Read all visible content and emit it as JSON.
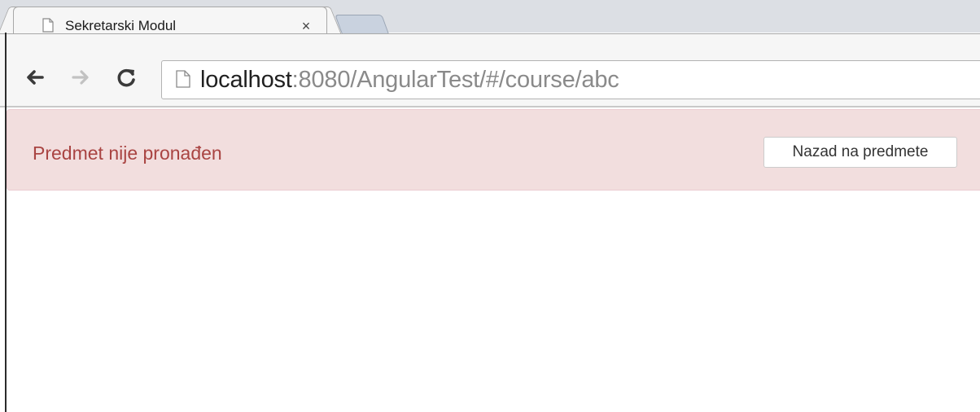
{
  "browser": {
    "tab": {
      "title": "Sekretarski Modul",
      "close_glyph": "×",
      "icon": "page-icon"
    },
    "new_tab_icon": "new-tab-icon",
    "nav": {
      "back_icon": "back-arrow-icon",
      "forward_icon": "forward-arrow-icon",
      "reload_icon": "reload-icon"
    },
    "omnibox": {
      "icon": "page-icon",
      "url_host": "localhost",
      "url_rest": ":8080/AngularTest/#/course/abc"
    }
  },
  "page": {
    "alert": {
      "message": "Predmet nije pronađen",
      "button_label": "Nazad na predmete"
    }
  },
  "colors": {
    "alert_background": "#f2dede",
    "alert_border": "#ebccd1",
    "alert_text": "#a94442"
  }
}
